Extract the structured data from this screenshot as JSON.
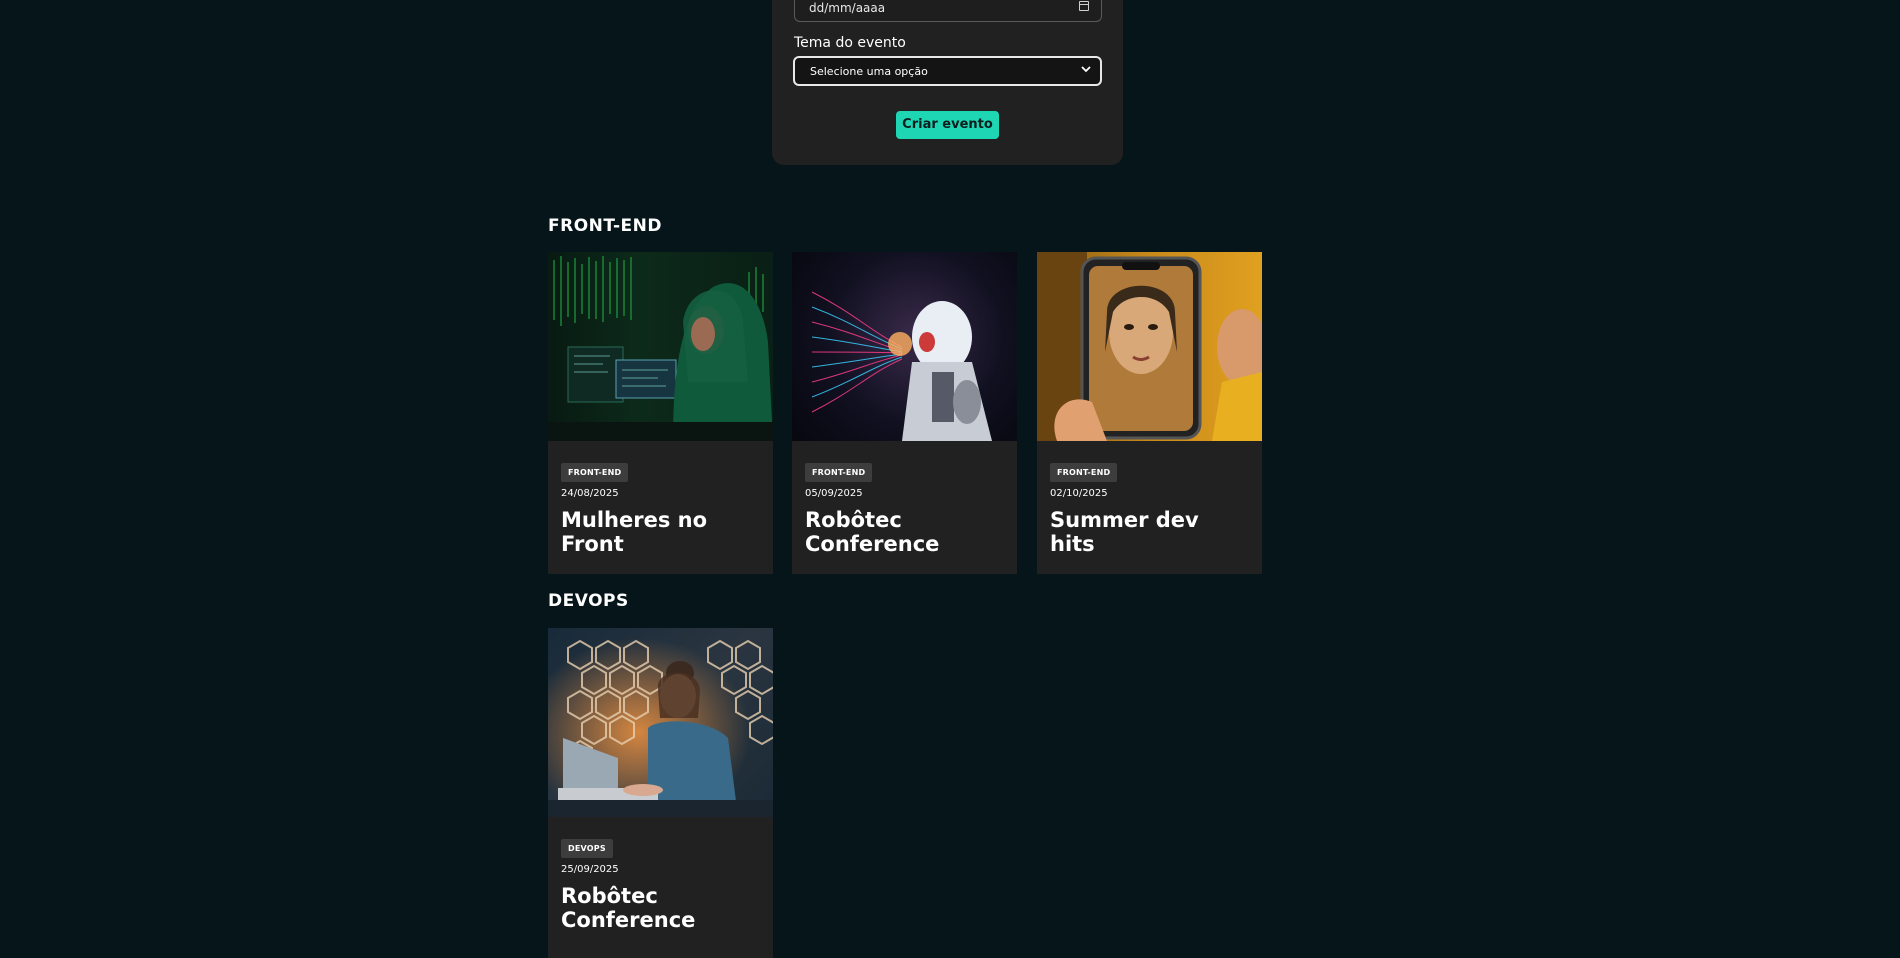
{
  "form": {
    "date_placeholder": "dd/mm/aaaa",
    "theme_label": "Tema do evento",
    "theme_select_value": "Selecione uma opção",
    "submit_label": "Criar evento"
  },
  "sections": [
    {
      "title": "FRONT-END",
      "cards": [
        {
          "tag": "FRONT-END",
          "date": "24/08/2025",
          "title": "Mulheres no Front"
        },
        {
          "tag": "FRONT-END",
          "date": "05/09/2025",
          "title": "Robôtec Conference"
        },
        {
          "tag": "FRONT-END",
          "date": "02/10/2025",
          "title": "Summer dev hits"
        }
      ]
    },
    {
      "title": "DEVOPS",
      "cards": [
        {
          "tag": "DEVOPS",
          "date": "25/09/2025",
          "title": "Robôtec Conference"
        }
      ]
    }
  ],
  "colors": {
    "background": "#06151a",
    "panel": "#212121",
    "accent": "#1ed6b4",
    "tag_bg": "#3d3d3d"
  }
}
